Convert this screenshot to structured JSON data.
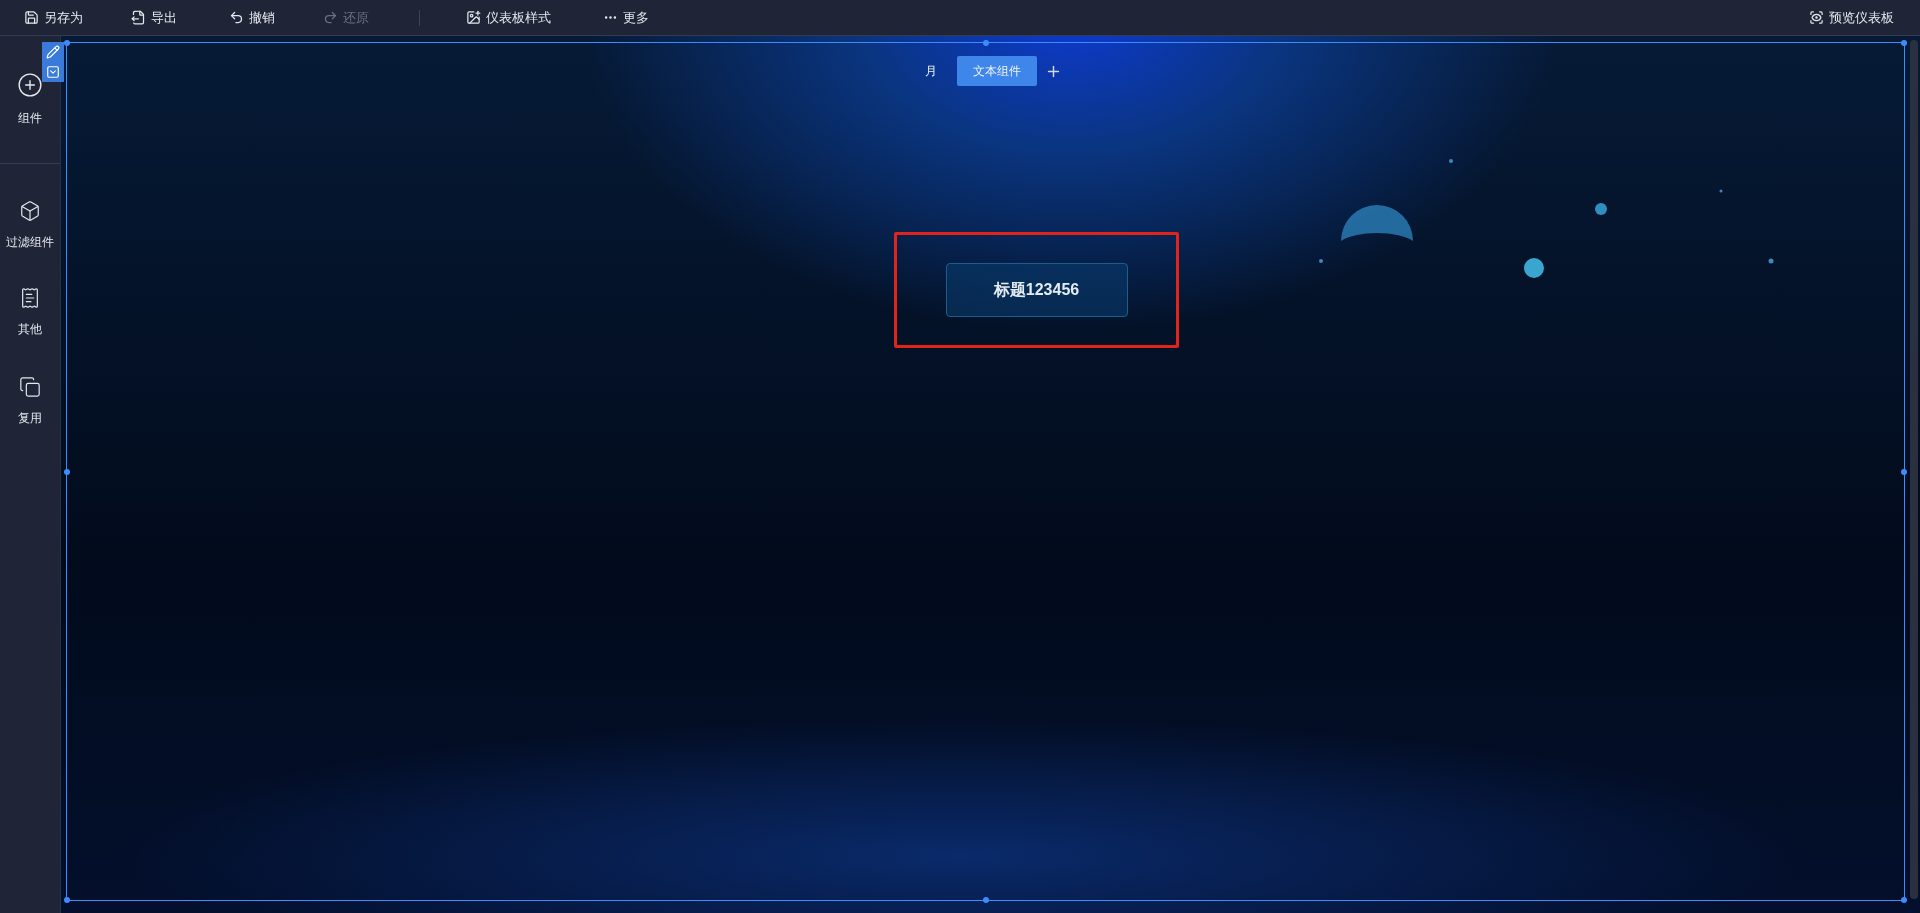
{
  "toolbar": {
    "items": [
      {
        "label": "另存为",
        "disabled": false
      },
      {
        "label": "导出",
        "disabled": false
      },
      {
        "label": "撤销",
        "disabled": false
      },
      {
        "label": "还原",
        "disabled": true
      },
      {
        "label": "仪表板样式",
        "disabled": false
      },
      {
        "label": "更多",
        "disabled": false
      }
    ],
    "preview": {
      "label": "预览仪表板"
    }
  },
  "sidebar": {
    "items": [
      {
        "label": "组件"
      },
      {
        "label": "过滤组件"
      },
      {
        "label": "其他"
      },
      {
        "label": "复用"
      }
    ]
  },
  "tabs": [
    {
      "label": "月",
      "selected": false
    },
    {
      "label": "文本组件",
      "selected": true
    }
  ],
  "title_widget": {
    "text": "标题123456"
  }
}
